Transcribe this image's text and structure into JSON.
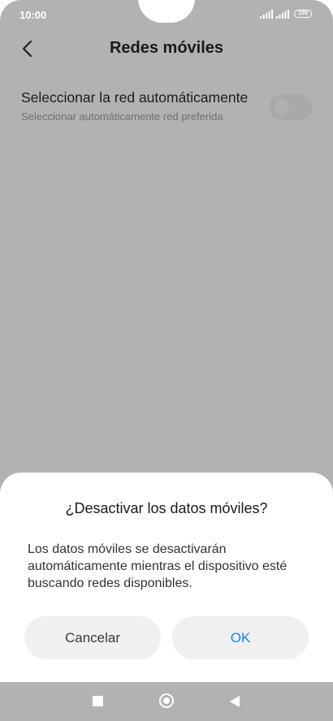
{
  "status_bar": {
    "time": "10:00",
    "battery": "100",
    "icons": [
      "signal-icon",
      "signal-icon",
      "battery-icon"
    ]
  },
  "header": {
    "title": "Redes móviles",
    "back_icon": "chevron-left-icon"
  },
  "setting": {
    "title": "Seleccionar la red automáticamente",
    "subtitle": "Seleccionar automáticamente red preferida",
    "toggle_on": false
  },
  "dialog": {
    "title": "¿Desactivar los datos móviles?",
    "message": "Los datos móviles se desactivarán automáticamente mientras el dispositivo esté buscando redes disponibles.",
    "cancel_label": "Cancelar",
    "ok_label": "OK"
  },
  "nav_bar": {
    "icons": [
      "recents-icon",
      "home-icon",
      "back-icon"
    ]
  },
  "colors": {
    "accent": "#0d84ff",
    "scrim": "#b2b2b2",
    "dialog_bg": "#ffffff"
  }
}
